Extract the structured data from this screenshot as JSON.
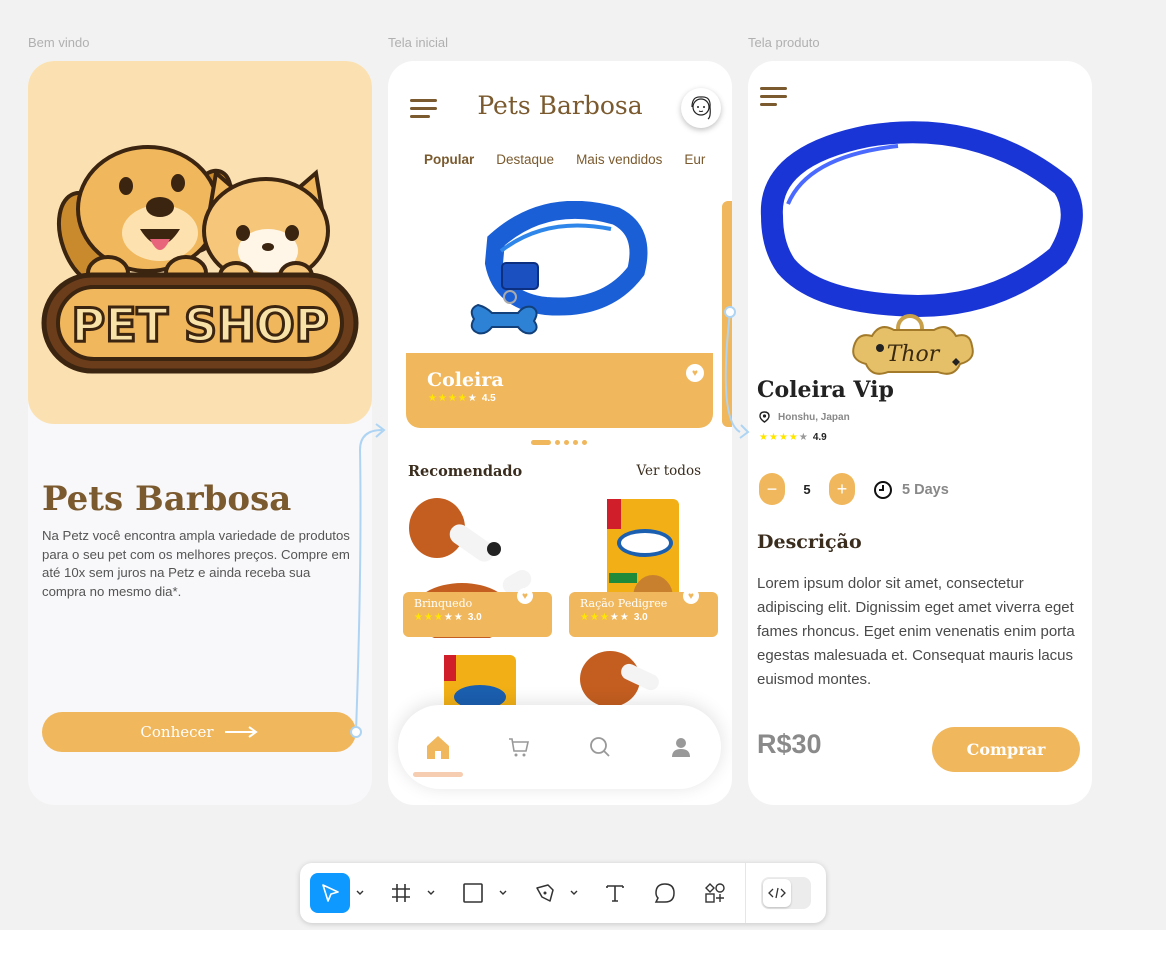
{
  "canvas": {
    "frame_labels": [
      "Bem vindo",
      "Tela inicial",
      "Tela produto"
    ]
  },
  "welcome": {
    "logo_text": "PET SHOP",
    "title": "Pets Barbosa",
    "description": "Na Petz você encontra ampla variedade de produtos para o seu pet com os melhores preços. Compre em até 10x sem juros na Petz e ainda receba sua compra no mesmo dia*.",
    "cta_label": "Conhecer"
  },
  "home": {
    "title": "Pets Barbosa",
    "tabs": [
      {
        "label": "Popular",
        "active": true
      },
      {
        "label": "Destaque",
        "active": false
      },
      {
        "label": "Mais vendidos",
        "active": false
      },
      {
        "label": "Eur",
        "active": false
      }
    ],
    "featured": {
      "name": "Coleira",
      "rating": "4.5",
      "stars": 4
    },
    "carousel": {
      "pages": 5,
      "current": 1
    },
    "recommended_title": "Recomendado",
    "see_all_label": "Ver todos",
    "recommended": [
      {
        "name": "Brinquedo",
        "rating": "3.0",
        "stars": 3
      },
      {
        "name": "Ração Pedigree",
        "rating": "3.0",
        "stars": 3
      }
    ],
    "bottom_nav": [
      "home-icon",
      "cart-icon",
      "search-icon",
      "user-icon"
    ],
    "bottom_nav_active": "home-icon"
  },
  "product": {
    "tag_text": "Thor",
    "name": "Coleira Vip",
    "location": "Honshu, Japan",
    "rating": "4.9",
    "stars": 4,
    "quantity": "5",
    "minus_label": "−",
    "plus_label": "+",
    "delivery": "5 Days",
    "description_title": "Descrição",
    "description": "Lorem ipsum dolor sit amet, consectetur adipiscing elit. Dignissim eget amet viverra eget fames rhoncus. Eget enim venenatis enim porta egestas malesuada et. Consequat mauris lacus euismod montes.",
    "price": "R$30",
    "buy_label": "Comprar"
  },
  "toolbar": {
    "tools": [
      "move-tool",
      "frame-tool",
      "shape-tool",
      "pen-tool",
      "text-tool",
      "comment-tool",
      "assets-tool"
    ],
    "selected": "move-tool",
    "dev_mode_icon": "code-icon"
  },
  "colors": {
    "accent": "#f0b75c",
    "brand_brown": "#7a5a2e",
    "hero_bg": "#fbe1b2",
    "selection_blue": "#0d99ff",
    "star": "#ffe600",
    "product_blue": "#1a3cd6"
  }
}
